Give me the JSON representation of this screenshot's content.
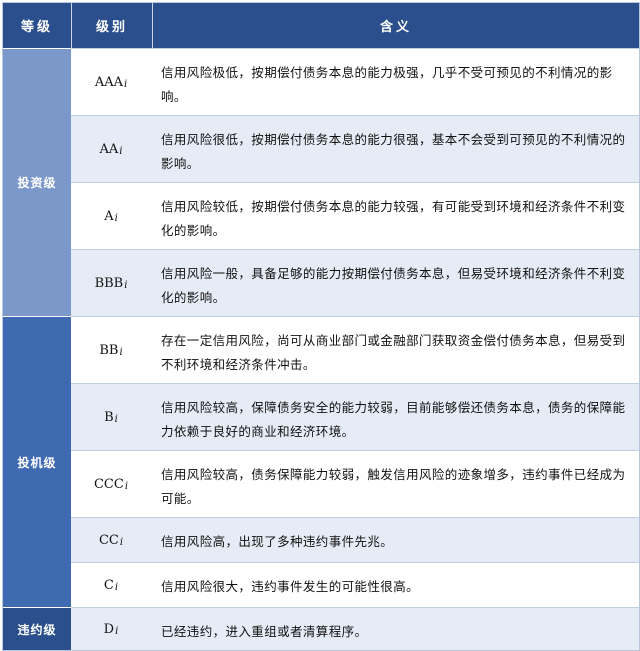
{
  "header": {
    "grade": "等级",
    "level": "级别",
    "meaning": "含义"
  },
  "groups": [
    {
      "name": "投资级",
      "rows": [
        {
          "level": "AAA",
          "suffix": "i",
          "meaning": "信用风险极低，按期偿付债务本息的能力极强，几乎不受可预见的不利情况的影响。"
        },
        {
          "level": "AA",
          "suffix": "i",
          "meaning": "信用风险很低，按期偿付债务本息的能力很强，基本不会受到可预见的不利情况的影响。"
        },
        {
          "level": "A",
          "suffix": "i",
          "meaning": "信用风险较低，按期偿付债务本息的能力较强，有可能受到环境和经济条件不利变化的影响。"
        },
        {
          "level": "BBB",
          "suffix": "i",
          "meaning": "信用风险一般，具备足够的能力按期偿付债务本息，但易受环境和经济条件不利变化的影响。"
        }
      ]
    },
    {
      "name": "投机级",
      "rows": [
        {
          "level": "BB",
          "suffix": "i",
          "meaning": "存在一定信用风险，尚可从商业部门或金融部门获取资金偿付债务本息，但易受到不利环境和经济条件冲击。"
        },
        {
          "level": "B",
          "suffix": "i",
          "meaning": "信用风险较高，保障债务安全的能力较弱，目前能够偿还债务本息，债务的保障能力依赖于良好的商业和经济环境。"
        },
        {
          "level": "CCC",
          "suffix": "i",
          "meaning": "信用风险较高，债务保障能力较弱，触发信用风险的迹象增多，违约事件已经成为可能。"
        },
        {
          "level": "CC",
          "suffix": "i",
          "meaning": "信用风险高，出现了多种违约事件先兆。"
        },
        {
          "level": "C",
          "suffix": "i",
          "meaning": "信用风险很大，违约事件发生的可能性很高。"
        }
      ]
    },
    {
      "name": "违约级",
      "rows": [
        {
          "level": "D",
          "suffix": "i",
          "meaning": "已经违约，进入重组或者清算程序。"
        }
      ]
    }
  ]
}
